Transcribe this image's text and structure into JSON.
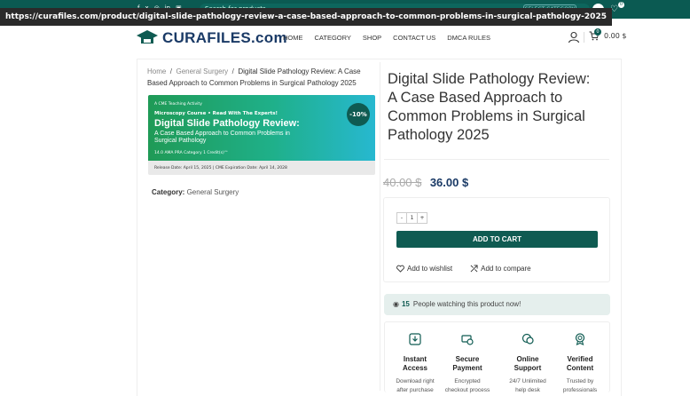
{
  "url_overlay": "https://curafiles.com/product/digital-slide-pathology-review-a-case-based-approach-to-common-problems-in-surgical-pathology-2025",
  "topbar": {
    "social": [
      "f",
      "x",
      "◎",
      "in",
      "▣"
    ],
    "search_placeholder": "Search for products",
    "search_icon": "search-icon",
    "language_box": "SELECT CATEGORY",
    "wishlist_count": "0"
  },
  "header": {
    "logo_name": "CURAFILES",
    "logo_domain": ".com",
    "nav": [
      "HOME",
      "CATEGORY",
      "SHOP",
      "CONTACT US",
      "DMCA RULES"
    ],
    "cart_count": "0",
    "cart_total": "0.00 $"
  },
  "breadcrumb": {
    "home": "Home",
    "sep": "/",
    "category": "General Surgery",
    "current": "Digital Slide Pathology Review: A Case Based Approach to Common Problems in Surgical Pathology 2025"
  },
  "image": {
    "activity": "A CME Teaching Activity",
    "course": "Microscopy Course • Read With The Experts!",
    "title": "Digital Slide Pathology Review:",
    "subtitle": "A Case Based Approach to Common Problems in Surgical Pathology",
    "credits": "14.0 AMA PRA Category 1 Credit(s)™",
    "release": "Release Date: April 15, 2025  |  CME Expiration Date: April 14, 2028"
  },
  "sale_badge": "-10%",
  "category": {
    "label": "Category:",
    "value": "General Surgery"
  },
  "product": {
    "title": "Digital Slide Pathology Review: A Case Based Approach to Common Problems in Surgical Pathology 2025",
    "old_price": "40.00 $",
    "new_price": "36.00 $",
    "qty_minus": "-",
    "qty_value": "1",
    "qty_plus": "+",
    "add_to_cart": "ADD TO CART",
    "wishlist": "Add to wishlist",
    "compare": "Add to compare",
    "watching_count": "15",
    "watching_text": "People watching this product now!"
  },
  "features": [
    {
      "icon": "download-icon",
      "title1": "Instant",
      "title2": "Access",
      "desc1": "Download right",
      "desc2": "after purchase"
    },
    {
      "icon": "secure-payment-icon",
      "title1": "Secure",
      "title2": "Payment",
      "desc1": "Encrypted",
      "desc2": "checkout process"
    },
    {
      "icon": "support-chat-icon",
      "title1": "Online",
      "title2": "Support",
      "desc1": "24/7 Unlimited",
      "desc2": "help desk"
    },
    {
      "icon": "verified-badge-icon",
      "title1": "Verified",
      "title2": "Content",
      "desc1": "Trusted by",
      "desc2": "professionals"
    }
  ],
  "colors": {
    "brand": "#0f5b52",
    "logo": "#1a3a66",
    "price": "#1a3a66"
  }
}
